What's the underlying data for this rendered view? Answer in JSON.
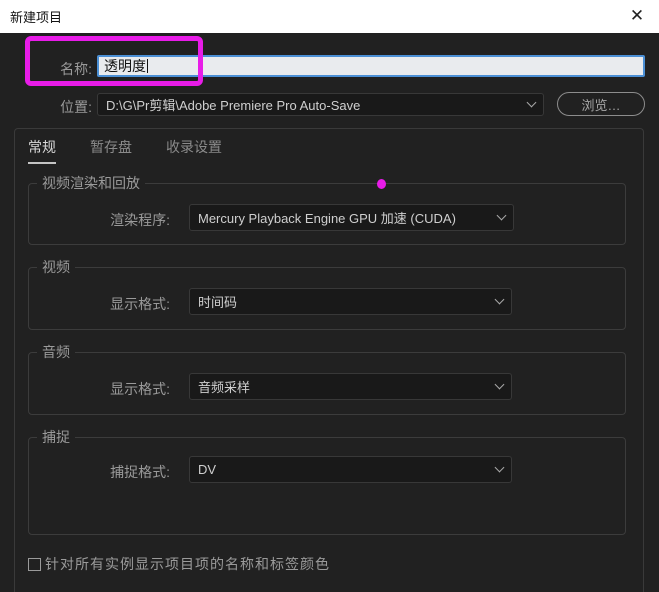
{
  "window": {
    "title": "新建项目",
    "close_glyph": "✕"
  },
  "name_row": {
    "label": "名称:",
    "value": "透明度"
  },
  "location_row": {
    "label": "位置:",
    "value": "D:\\G\\Pr剪辑\\Adobe Premiere Pro Auto-Save",
    "browse_label": "浏览…"
  },
  "tabs": [
    {
      "label": "常规",
      "active": true
    },
    {
      "label": "暂存盘",
      "active": false
    },
    {
      "label": "收录设置",
      "active": false
    }
  ],
  "sections": {
    "render": {
      "legend": "视频渲染和回放",
      "field_label": "渲染程序:",
      "value": "Mercury Playback Engine GPU 加速 (CUDA)"
    },
    "video": {
      "legend": "视频",
      "field_label": "显示格式:",
      "value": "时间码"
    },
    "audio": {
      "legend": "音频",
      "field_label": "显示格式:",
      "value": "音频采样"
    },
    "capture": {
      "legend": "捕捉",
      "field_label": "捕捉格式:",
      "value": "DV"
    }
  },
  "footer": {
    "checkbox_label": "针对所有实例显示项目项的名称和标签颜色",
    "checked": false
  },
  "annotations": {
    "highlight_color": "#e81ce8",
    "note": "magenta box around name field; magenta dot on render section border"
  }
}
